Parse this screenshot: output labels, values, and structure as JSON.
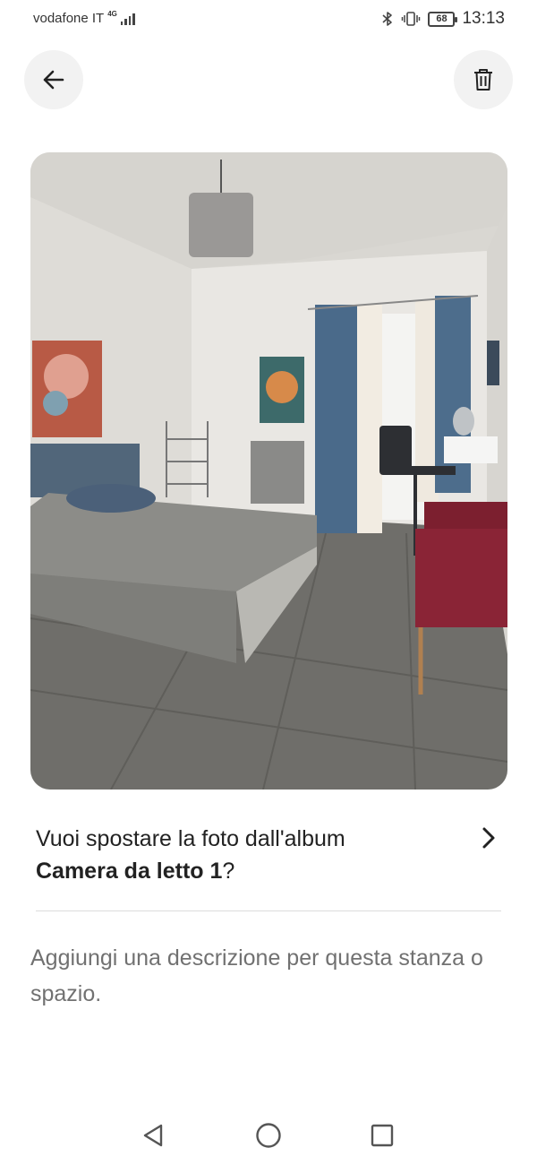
{
  "status_bar": {
    "carrier": "vodafone IT",
    "network_type": "4G",
    "battery_level": "68",
    "time": "13:13",
    "icons": [
      "signal-icon",
      "bluetooth-icon",
      "vibrate-icon",
      "battery-icon"
    ]
  },
  "header": {
    "back_icon": "arrow-left-icon",
    "delete_icon": "trash-icon"
  },
  "photo": {
    "subject": "bedroom-photo"
  },
  "album_prompt": {
    "text_before": "Vuoi spostare la foto dall'album",
    "album_name": "Camera da letto 1",
    "text_after": "?",
    "chevron_icon": "chevron-right-icon"
  },
  "description": {
    "placeholder": "Aggiungi una descrizione per questa stanza o spazio."
  },
  "nav_bar": {
    "icons": [
      "back-triangle-icon",
      "home-circle-icon",
      "recents-square-icon"
    ]
  },
  "colors": {
    "text_primary": "#222222",
    "text_secondary": "#717171",
    "button_bg": "#f2f2f2",
    "divider": "#dddddd"
  }
}
